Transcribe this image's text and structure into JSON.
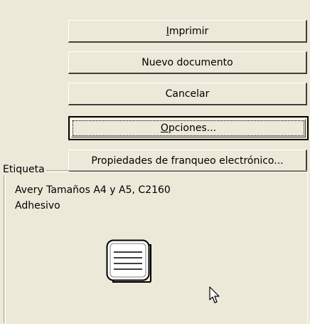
{
  "buttons": {
    "print": {
      "label": "Imprimir",
      "mnemonic": "I"
    },
    "new_document": {
      "label": "Nuevo documento",
      "mnemonic": "y"
    },
    "cancel": {
      "label": "Cancelar"
    },
    "options": {
      "label": "Opciones...",
      "mnemonic": "O"
    },
    "electronic_postage_properties": {
      "label": "Propiedades de franqueo electrónico..."
    }
  },
  "label_group": {
    "title": "Etiqueta",
    "vendor_line": "Avery Tamaños A4 y A5, C2160",
    "type_line": "Adhesivo",
    "preview_icon": "label-sheet-icon"
  },
  "cursor_icon": "mouse-pointer-icon",
  "colors": {
    "dialog_bg": "#ece9d8",
    "group_border": "#aca899"
  }
}
